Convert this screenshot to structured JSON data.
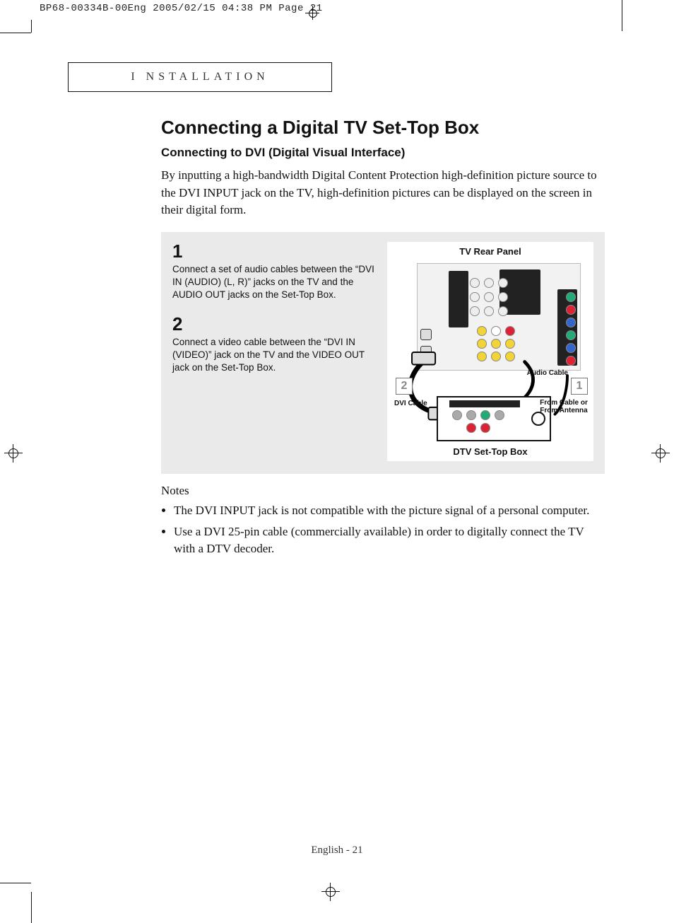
{
  "print_meta": "BP68-00334B-00Eng  2005/02/15  04:38 PM  Page 21",
  "section_header": "I NSTALLATION",
  "title": "Connecting a Digital TV Set-Top Box",
  "subtitle": "Connecting to DVI (Digital Visual Interface)",
  "lead": "By inputting a high-bandwidth Digital Content Protection high-definition picture source to the DVI INPUT jack on the TV, high-definition pictures can be displayed on the screen in their digital form.",
  "steps": [
    {
      "num": "1",
      "text": "Connect a set of audio cables between the “DVI IN (AUDIO) (L, R)” jacks on the TV and the AUDIO OUT jacks on the Set-Top Box."
    },
    {
      "num": "2",
      "text": "Connect a video cable between the “DVI IN (VIDEO)” jack on the TV and the VIDEO OUT jack on the Set-Top Box."
    }
  ],
  "diagram": {
    "top_title": "TV Rear Panel",
    "bottom_title": "DTV Set-Top Box",
    "badge1": "1",
    "badge2": "2",
    "label_audio": "Audio Cable",
    "label_dvi": "DVI Cable",
    "label_cable": "From Cable or From Antenna"
  },
  "notes_heading": "Notes",
  "notes": [
    "The DVI INPUT jack is not compatible with the picture signal of a personal computer.",
    "Use a DVI 25-pin cable (commercially available) in order to digitally connect the TV with a DTV decoder."
  ],
  "footer": "English - 21"
}
